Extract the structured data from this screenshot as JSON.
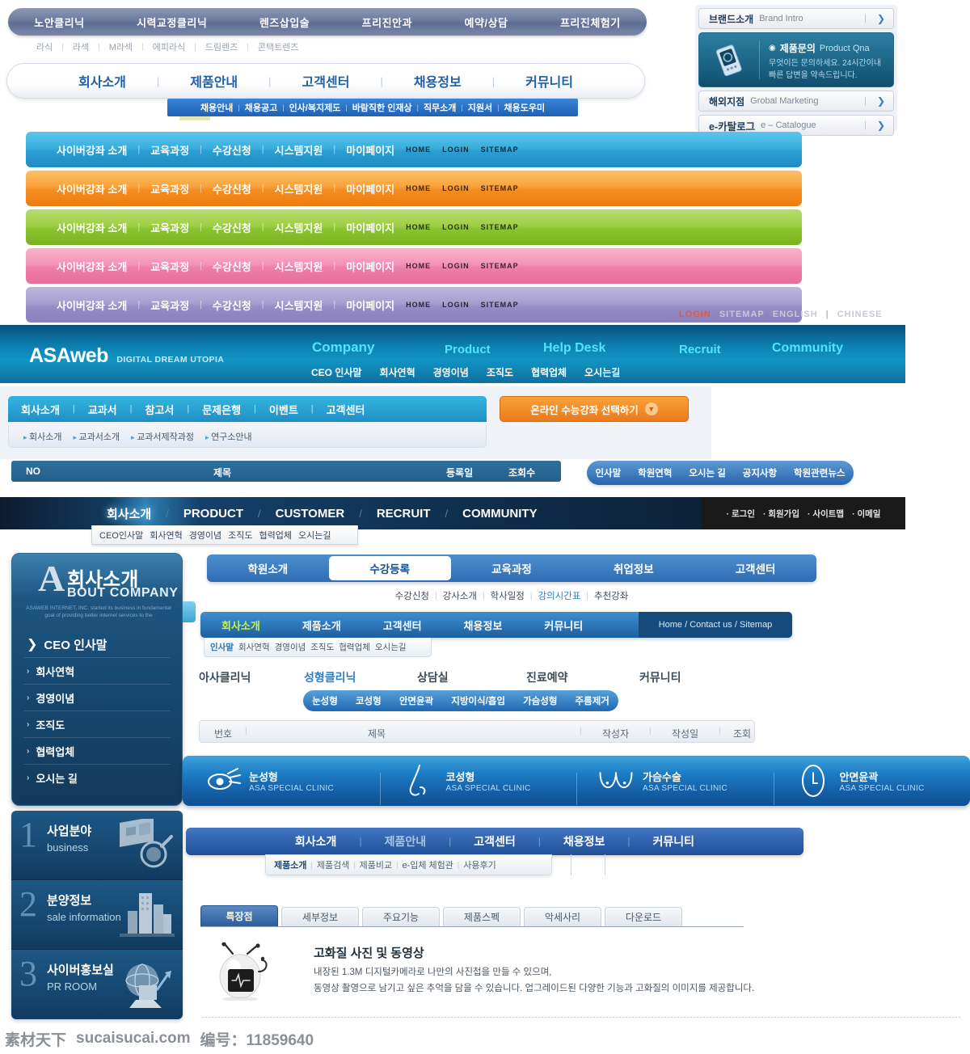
{
  "top_pill_nav": {
    "items": [
      "노안클리닉",
      "시력교정클리닉",
      "렌즈삽입술",
      "프리진안과",
      "예약/상담",
      "프리진체험기"
    ]
  },
  "top_sub_links": {
    "items": [
      "라식",
      "라섹",
      "M라섹",
      "에피라식",
      "드림렌즈",
      "콘택트렌즈"
    ]
  },
  "white_nav": {
    "items": [
      "회사소개",
      "제품안내",
      "고객센터",
      "채용정보",
      "커뮤니티"
    ],
    "sub_items": [
      "채용안내",
      "채용공고",
      "인사/복지제도",
      "바람직한 인재상",
      "직무소개",
      "지원서",
      "채용도우미"
    ]
  },
  "color_bars": {
    "items": [
      "사이버강좌 소개",
      "교육과정",
      "수강신청",
      "시스템지원",
      "마이페이지"
    ],
    "mini_items": [
      "HOME",
      "LOGIN",
      "SITEMAP"
    ],
    "colors": [
      "#3cadde",
      "#f7941e",
      "#8cc63f",
      "#f48bb4",
      "#9b93c9"
    ]
  },
  "util_strip": {
    "items": [
      "LOGIN",
      "SITEMAP",
      "ENGLISH",
      "CHINESE"
    ],
    "login_color": "#e8543f",
    "normal_color": "#c9c7d6"
  },
  "asaweb": {
    "logo_main": "ASAweb",
    "logo_tagline": "DIGITAL DREAM UTOPIA",
    "groups": [
      "Company",
      "Product",
      "Help Desk",
      "Recruit",
      "Community"
    ],
    "sub_items": [
      "CEO 인사말",
      "회사연혁",
      "경영이념",
      "조직도",
      "협력업체",
      "오시는길"
    ],
    "accent": "#4fe4ff"
  },
  "cyan_bar": {
    "items": [
      "회사소개",
      "교과서",
      "참고서",
      "문제은행",
      "이벤트",
      "고객센터"
    ],
    "breadcrumbs": [
      "회사소개",
      "교과서소개",
      "교과서제작과정",
      "연구소안내"
    ],
    "orange_button": "온라인 수능강좌 선택하기"
  },
  "table_header": {
    "columns": [
      "NO",
      "제목",
      "등록일",
      "조회수"
    ]
  },
  "pill_subnav": {
    "items": [
      "인사말",
      "학원연혁",
      "오시는 길",
      "공지사항",
      "학원관련뉴스"
    ]
  },
  "navy_nav": {
    "items": [
      "회사소개",
      "PRODUCT",
      "CUSTOMER",
      "RECRUIT",
      "COMMUNITY"
    ],
    "active_index": 0,
    "utility": [
      "로그인",
      "회원가입",
      "사이트맵",
      "이메일"
    ],
    "sub_items": [
      "CEO인사말",
      "회사연혁",
      "경영이념",
      "조직도",
      "협력업체",
      "오시는길"
    ]
  },
  "sidebar": {
    "initial": "A",
    "title_ko": "회사소개",
    "title_en": "BOUT COMPANY",
    "description": "ASAWEB INTERNET, INC. started its business in fundamental goal of providing better internet services to the",
    "items": [
      {
        "label": "CEO 인사말",
        "active": true
      },
      {
        "label": "회사연혁",
        "active": false
      },
      {
        "label": "경영이념",
        "active": false
      },
      {
        "label": "조직도",
        "active": false
      },
      {
        "label": "협력업체",
        "active": false
      },
      {
        "label": "오시는 길",
        "active": false
      }
    ]
  },
  "promos": [
    {
      "num": "1",
      "ko": "사업분야",
      "en": "business"
    },
    {
      "num": "2",
      "ko": "분양정보",
      "en": "sale information"
    },
    {
      "num": "3",
      "ko": "사이버홍보실",
      "en": "PR ROOM"
    }
  ],
  "tabbar1": {
    "tabs": [
      {
        "label": "학원소개",
        "active": false
      },
      {
        "label": "수강등록",
        "active": true
      },
      {
        "label": "교육과정",
        "active": false
      },
      {
        "label": "취업정보",
        "active": false
      },
      {
        "label": "고객센터",
        "active": false
      }
    ],
    "sub_items": [
      {
        "label": "수강신청",
        "highlight": false
      },
      {
        "label": "강사소개",
        "highlight": false
      },
      {
        "label": "학사일정",
        "highlight": false
      },
      {
        "label": "강의시간표",
        "highlight": true
      },
      {
        "label": "추천강좌",
        "highlight": false
      }
    ]
  },
  "tabbar2": {
    "tabs": [
      {
        "label": "회사소개",
        "active": true
      },
      {
        "label": "제품소개",
        "active": false
      },
      {
        "label": "고객센터",
        "active": false
      },
      {
        "label": "채용정보",
        "active": false
      },
      {
        "label": "커뮤니티",
        "active": false
      }
    ],
    "right_links": "Home  /  Contact us  /  Sitemap",
    "sub_items": [
      {
        "label": "인사말",
        "highlight": true
      },
      {
        "label": "회사연혁",
        "highlight": false
      },
      {
        "label": "경영이념",
        "highlight": false
      },
      {
        "label": "조직도",
        "highlight": false
      },
      {
        "label": "협력업체",
        "highlight": false
      },
      {
        "label": "오시는길",
        "highlight": false
      }
    ]
  },
  "clinic_nav": {
    "items": [
      {
        "label": "아사클리닉",
        "active": false
      },
      {
        "label": "성형클리닉",
        "active": true
      },
      {
        "label": "상담실",
        "active": false
      },
      {
        "label": "진료예약",
        "active": false
      },
      {
        "label": "커뮤니티",
        "active": false
      }
    ],
    "pill_items": [
      "눈성형",
      "코성형",
      "안면윤곽",
      "지방이식/흡입",
      "가슴성형",
      "주름제거"
    ]
  },
  "board_header": {
    "columns": [
      "번호",
      "제목",
      "작성자",
      "작성일",
      "조회"
    ]
  },
  "clinic_banner": {
    "items": [
      {
        "ko": "눈성형",
        "en": "ASA SPECIAL CLINIC",
        "icon": "eye-icon"
      },
      {
        "ko": "코성형",
        "en": "ASA SPECIAL CLINIC",
        "icon": "nose-icon"
      },
      {
        "ko": "가슴수술",
        "en": "ASA SPECIAL CLINIC",
        "icon": "breast-icon"
      },
      {
        "ko": "안면윤곽",
        "en": "ASA SPECIAL CLINIC",
        "icon": "face-icon"
      }
    ]
  },
  "bottom_nav": {
    "items": [
      {
        "label": "회사소개",
        "dim": false
      },
      {
        "label": "제품안내",
        "dim": true
      },
      {
        "label": "고객센터",
        "dim": false
      },
      {
        "label": "채용정보",
        "dim": false
      },
      {
        "label": "커뮤니티",
        "dim": false
      }
    ],
    "sub_items": [
      {
        "label": "제품소개",
        "highlight": true
      },
      {
        "label": "제품검색",
        "highlight": false
      },
      {
        "label": "제품비교",
        "highlight": false
      },
      {
        "label": "e-입체 체험관",
        "highlight": false
      },
      {
        "label": "사용후기",
        "highlight": false
      }
    ]
  },
  "product_tabs": {
    "tabs": [
      {
        "label": "특장점",
        "active": true
      },
      {
        "label": "세부정보",
        "active": false
      },
      {
        "label": "주요기능",
        "active": false
      },
      {
        "label": "제품스펙",
        "active": false
      },
      {
        "label": "악세사리",
        "active": false
      },
      {
        "label": "다운로드",
        "active": false
      }
    ]
  },
  "feature": {
    "title": "고화질 사진 및 동영상",
    "line1": "내장된 1.3M 디지털카메라로 나만의 사진첩을 만들 수 있으며,",
    "line2": "동영상 촬영으로 남기고 싶은 추억을 담을 수 있습니다. 업그레이드된 다양한 기능과 고화질의 이미지를 제공합니다."
  },
  "footer": {
    "site_ko": "素材天下",
    "site_url": "sucaisucai.com",
    "id_label": "编号：11859640"
  }
}
